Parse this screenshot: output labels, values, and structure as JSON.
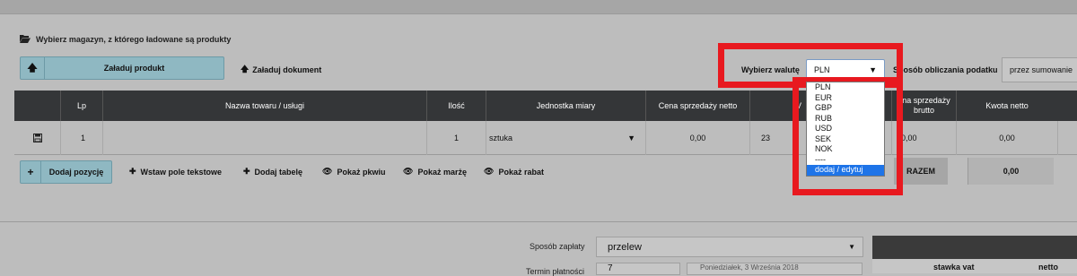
{
  "warehouse": {
    "title": "Wybierz magazyn, z którego ładowane są produkty",
    "upload_product": "Załaduj produkt",
    "upload_document": "Załaduj dokument"
  },
  "table": {
    "headers": [
      "Lp",
      "Nazwa towaru / usługi",
      "Ilość",
      "Jednostka miary",
      "Cena sprzedaży netto",
      "V",
      "ena sprzedaży\nbrutto",
      "Kwota netto"
    ],
    "row": {
      "lp": "1",
      "name": "",
      "qty": "1",
      "unit": "sztuka",
      "net_price": "0,00",
      "vat": "23",
      "gross_price": "0,00",
      "net_amount": "0,00"
    }
  },
  "toolbar": {
    "add_position": "Dodaj pozycję",
    "insert_text": "Wstaw pole tekstowe",
    "add_table": "Dodaj tabelę",
    "show_pkwiu": "Pokaż pkwiu",
    "show_margin": "Pokaż marżę",
    "show_discount": "Pokaż rabat"
  },
  "totals": {
    "label": "RAZEM",
    "value": "0,00"
  },
  "currency": {
    "label": "Wybierz walutę",
    "selected": "PLN",
    "options": [
      "PLN",
      "EUR",
      "GBP",
      "RUB",
      "USD",
      "SEK",
      "NOK",
      "----",
      "dodaj / edytuj"
    ]
  },
  "tax_method": {
    "label": "Sposób obliczania podatku",
    "value": "przez sumowanie"
  },
  "payment": {
    "label": "Sposób zapłaty",
    "value": "przelew",
    "term_label": "Termin płatności",
    "term_value": "7",
    "term_date": "Poniedziałek, 3 Września 2018"
  },
  "vat_table": {
    "col_rate": "stawka vat",
    "col_net": "netto"
  },
  "colors": {
    "highlight": "#e8191f",
    "button": "#8fb8c2",
    "header": "#343638"
  }
}
